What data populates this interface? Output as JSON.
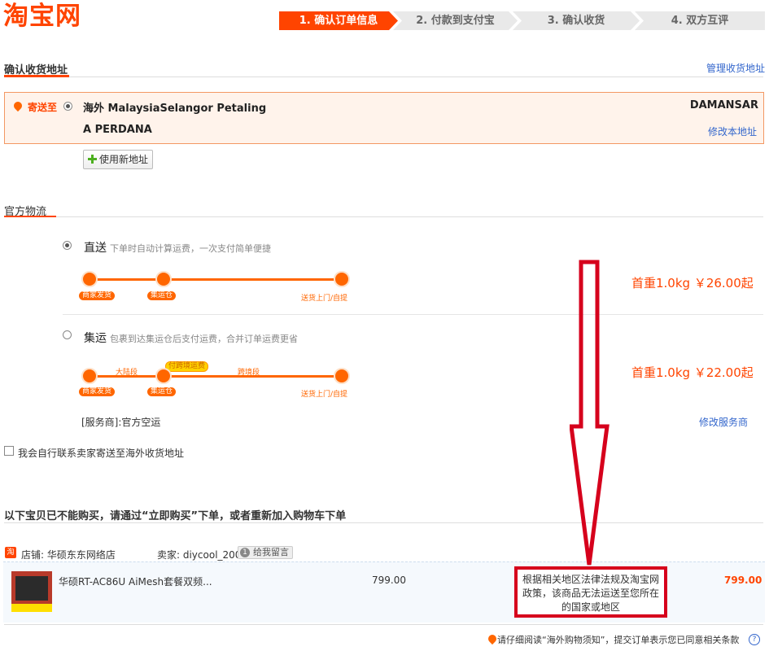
{
  "logo": "淘宝网",
  "steps": [
    "1. 确认订单信息",
    "2. 付款到支付宝",
    "3. 确认收货",
    "4. 双方互评"
  ],
  "address_section": {
    "title": "确认收货地址",
    "manage_link": "管理收货地址",
    "ship_to_label": "寄送至",
    "address_line1": "海外 MalaysiaSelangor Petaling",
    "address_line1_right": "DAMANSAR",
    "address_line2": "A PERDANA",
    "edit_link": "修改本地址",
    "new_address_button": "使用新地址"
  },
  "logistics": {
    "title": "官方物流",
    "options": [
      {
        "name": "直送",
        "desc": "下单时自动计算运费，一次支付简单便捷",
        "price": "首重1.0kg ￥26.00起",
        "nodes": [
          "商家发货",
          "集运仓",
          "送货上门/自提"
        ]
      },
      {
        "name": "集运",
        "desc": "包裹到达集运仓后支付运费，合并订单运费更省",
        "price": "首重1.0kg ￥22.00起",
        "nodes": [
          "商家发货",
          "集运仓",
          "送货上门/自提"
        ],
        "segments": [
          "大陆段",
          "跨境段"
        ],
        "badge": "付跨境运费",
        "provider": "[服务商]:官方空运",
        "edit_provider": "修改服务商"
      }
    ]
  },
  "self_contact": "我会自行联系卖家寄送至海外收货地址",
  "unavailable_title": "以下宝贝已不能购买，请通过“立即购买”下单，或者重新加入购物车下单",
  "shop": {
    "icon": "淘",
    "shop_label": "店铺: 华硕东东网络店",
    "seller_label": "卖家: diycool_2005",
    "message_button": "给我留言"
  },
  "item": {
    "title": "华硕RT-AC86U AiMesh套餐双频...",
    "unit_price": "799.00",
    "notice": "根据相关地区法律法规及淘宝网政策，该商品无法运送至您所在的国家或地区",
    "total": "799.00"
  },
  "footer_notice": "请仔细阅读“海外购物须知”，提交订单表示您已同意相关条款",
  "colors": {
    "brand": "#ff4400",
    "link": "#3366cc",
    "annotation": "#d6001c"
  }
}
